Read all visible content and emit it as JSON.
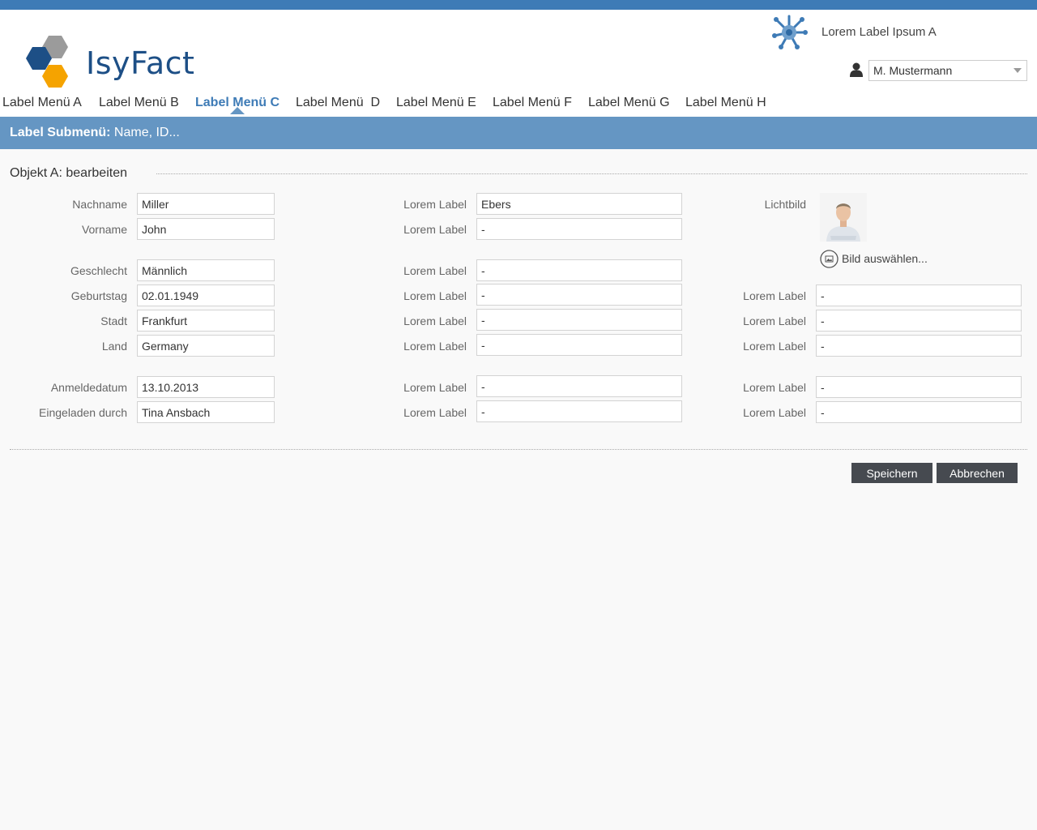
{
  "header": {
    "logo_text": "IsyFact",
    "app_label": "Lorem Label Ipsum A",
    "user": {
      "selected": "M. Mustermann"
    }
  },
  "nav": {
    "items": [
      {
        "label": "Label Menü A"
      },
      {
        "label": "Label Menü B"
      },
      {
        "label": "Label Menü C"
      },
      {
        "label": "Label Menü  D"
      },
      {
        "label": "Label Menü E"
      },
      {
        "label": "Label Menü F"
      },
      {
        "label": "Label Menü G"
      },
      {
        "label": "Label Menü H"
      }
    ],
    "active_index": 2
  },
  "subbar": {
    "label": "Label Submenü:",
    "text": "Name, ID..."
  },
  "form": {
    "title": "Objekt A: bearbeiten",
    "col1": [
      {
        "label": "Nachname",
        "value": "Miller"
      },
      {
        "label": "Vorname",
        "value": "John"
      },
      {
        "label": "Geschlecht",
        "value": "Männlich"
      },
      {
        "label": "Geburtstag",
        "value": "02.01.1949"
      },
      {
        "label": "Stadt",
        "value": "Frankfurt"
      },
      {
        "label": "Land",
        "value": "Germany"
      },
      {
        "label": "Anmeldedatum",
        "value": "13.10.2013"
      },
      {
        "label": "Eingeladen durch",
        "value": "Tina Ansbach"
      }
    ],
    "col2": [
      {
        "label": "Lorem Label",
        "value": "Ebers"
      },
      {
        "label": "Lorem Label",
        "value": "-"
      },
      {
        "label": "Lorem Label",
        "value": "-"
      },
      {
        "label": "Lorem Label",
        "value": "-"
      },
      {
        "label": "Lorem Label",
        "value": "-"
      },
      {
        "label": "Lorem Label",
        "value": "-"
      },
      {
        "label": "Lorem Label",
        "value": "-"
      },
      {
        "label": "Lorem Label",
        "value": "-"
      }
    ],
    "col3": {
      "photo_label": "Lichtbild",
      "pick_photo": "Bild auswählen...",
      "rows": [
        {
          "label": "Lorem Label",
          "value": "-"
        },
        {
          "label": "Lorem Label",
          "value": "-"
        },
        {
          "label": "Lorem Label",
          "value": "-"
        },
        {
          "label": "Lorem Label",
          "value": "-"
        },
        {
          "label": "Lorem Label",
          "value": "-"
        }
      ]
    }
  },
  "buttons": {
    "save": "Speichern",
    "cancel": "Abbrechen"
  },
  "icons": {
    "logo": "isyfact-logo-icon",
    "app": "network-hub-icon",
    "user": "user-icon",
    "pick_photo": "image-pick-icon"
  },
  "colors": {
    "accent": "#3e7bb6",
    "subbar": "#6596c3",
    "button": "#464a50",
    "logo_blue": "#1d4f86",
    "logo_orange": "#f5a300",
    "logo_gray": "#9b9b9b"
  }
}
